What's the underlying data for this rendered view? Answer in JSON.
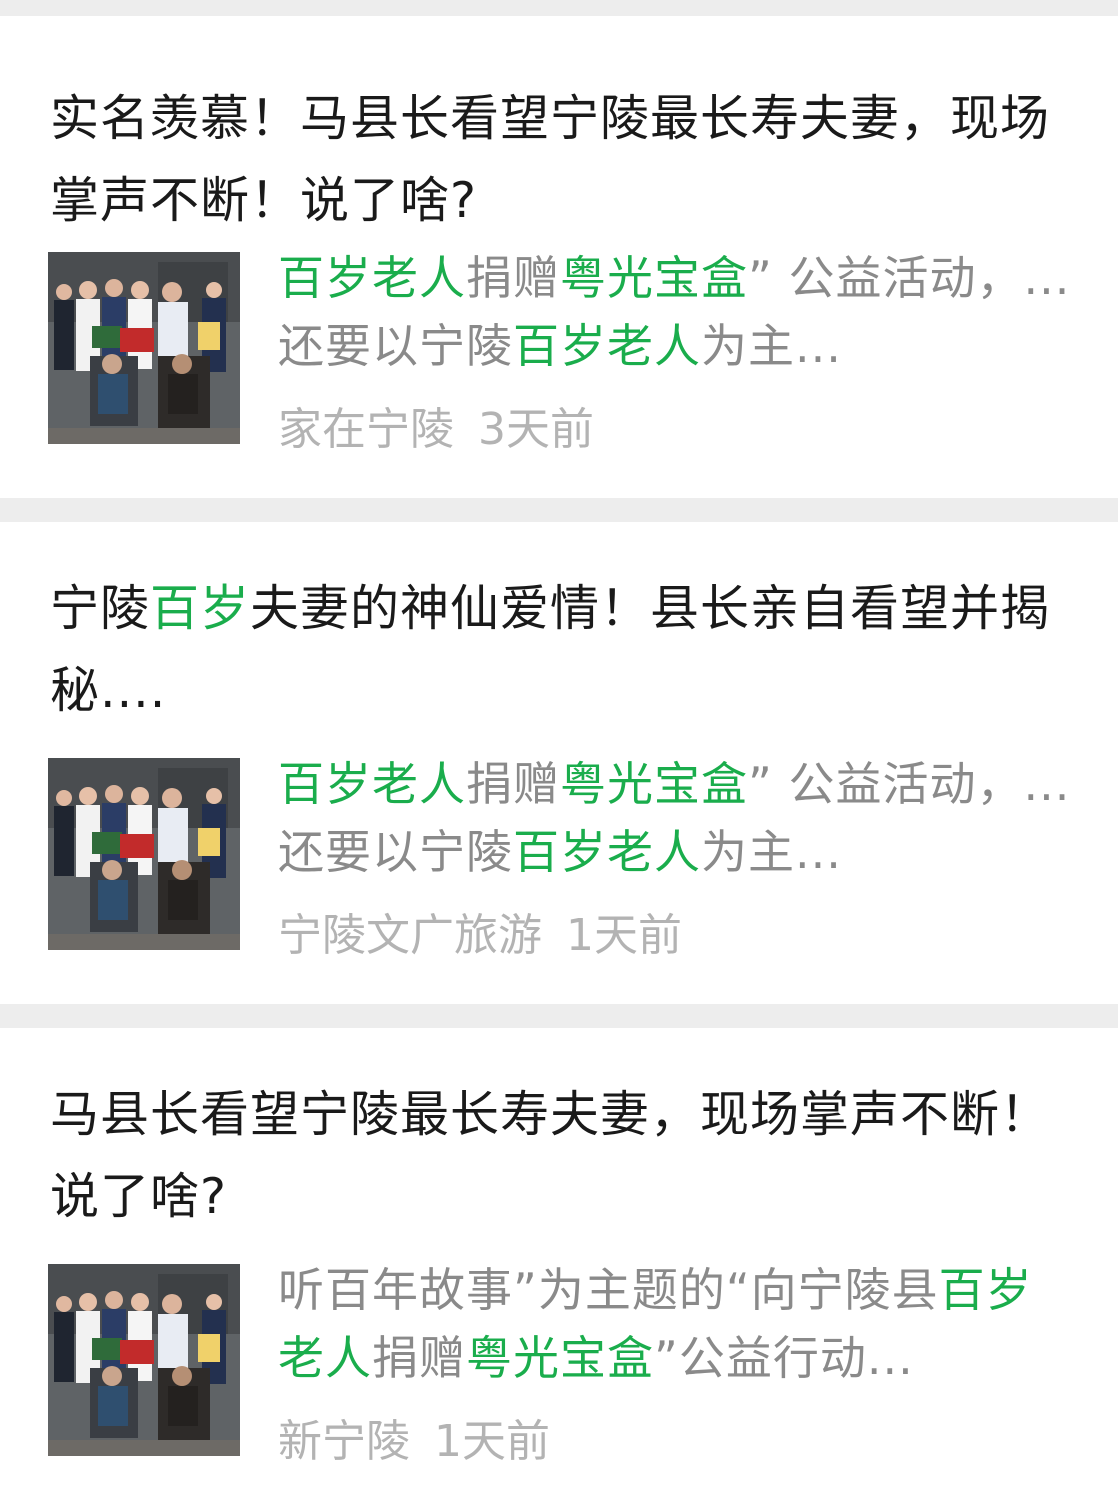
{
  "results": [
    {
      "title": [
        {
          "text": "实名羡慕！马县长看望宁陵最长寿夫妻，现场掌声不断！说了啥?",
          "hl": false
        }
      ],
      "snippet": [
        {
          "text": "百岁老人",
          "hl": true
        },
        {
          "text": "捐赠",
          "hl": false
        },
        {
          "text": "粤光宝盒",
          "hl": true
        },
        {
          "text": "” 公益活动，... 还要以宁陵",
          "hl": false
        },
        {
          "text": "百岁老人",
          "hl": true
        },
        {
          "text": "为主...",
          "hl": false
        }
      ],
      "source": "家在宁陵",
      "time": "3天前",
      "thumbnail": "group-photo-elderly-couple"
    },
    {
      "title": [
        {
          "text": "宁陵",
          "hl": false
        },
        {
          "text": "百岁",
          "hl": true
        },
        {
          "text": "夫妻的神仙爱情！县长亲自看望并揭秘....",
          "hl": false
        }
      ],
      "snippet": [
        {
          "text": "百岁老人",
          "hl": true
        },
        {
          "text": "捐赠",
          "hl": false
        },
        {
          "text": "粤光宝盒",
          "hl": true
        },
        {
          "text": "” 公益活动，... 还要以宁陵",
          "hl": false
        },
        {
          "text": "百岁老人",
          "hl": true
        },
        {
          "text": "为主...",
          "hl": false
        }
      ],
      "source": "宁陵文广旅游",
      "time": "1天前",
      "thumbnail": "group-photo-elderly-couple"
    },
    {
      "title": [
        {
          "text": "马县长看望宁陵最长寿夫妻，现场掌声不断！说了啥?",
          "hl": false
        }
      ],
      "snippet": [
        {
          "text": "听百年故事”为主题的“向宁陵县",
          "hl": false
        },
        {
          "text": "百岁老人",
          "hl": true
        },
        {
          "text": "捐赠",
          "hl": false
        },
        {
          "text": "粤光宝盒",
          "hl": true
        },
        {
          "text": "”公益行动...",
          "hl": false
        }
      ],
      "source": "新宁陵",
      "time": "1天前",
      "thumbnail": "group-photo-elderly-couple"
    }
  ],
  "colors": {
    "highlight": "#1aad4c",
    "title": "#1a1a1a",
    "snippet": "#8a8a8a",
    "meta": "#b3b3b3",
    "divider": "#ededed"
  }
}
